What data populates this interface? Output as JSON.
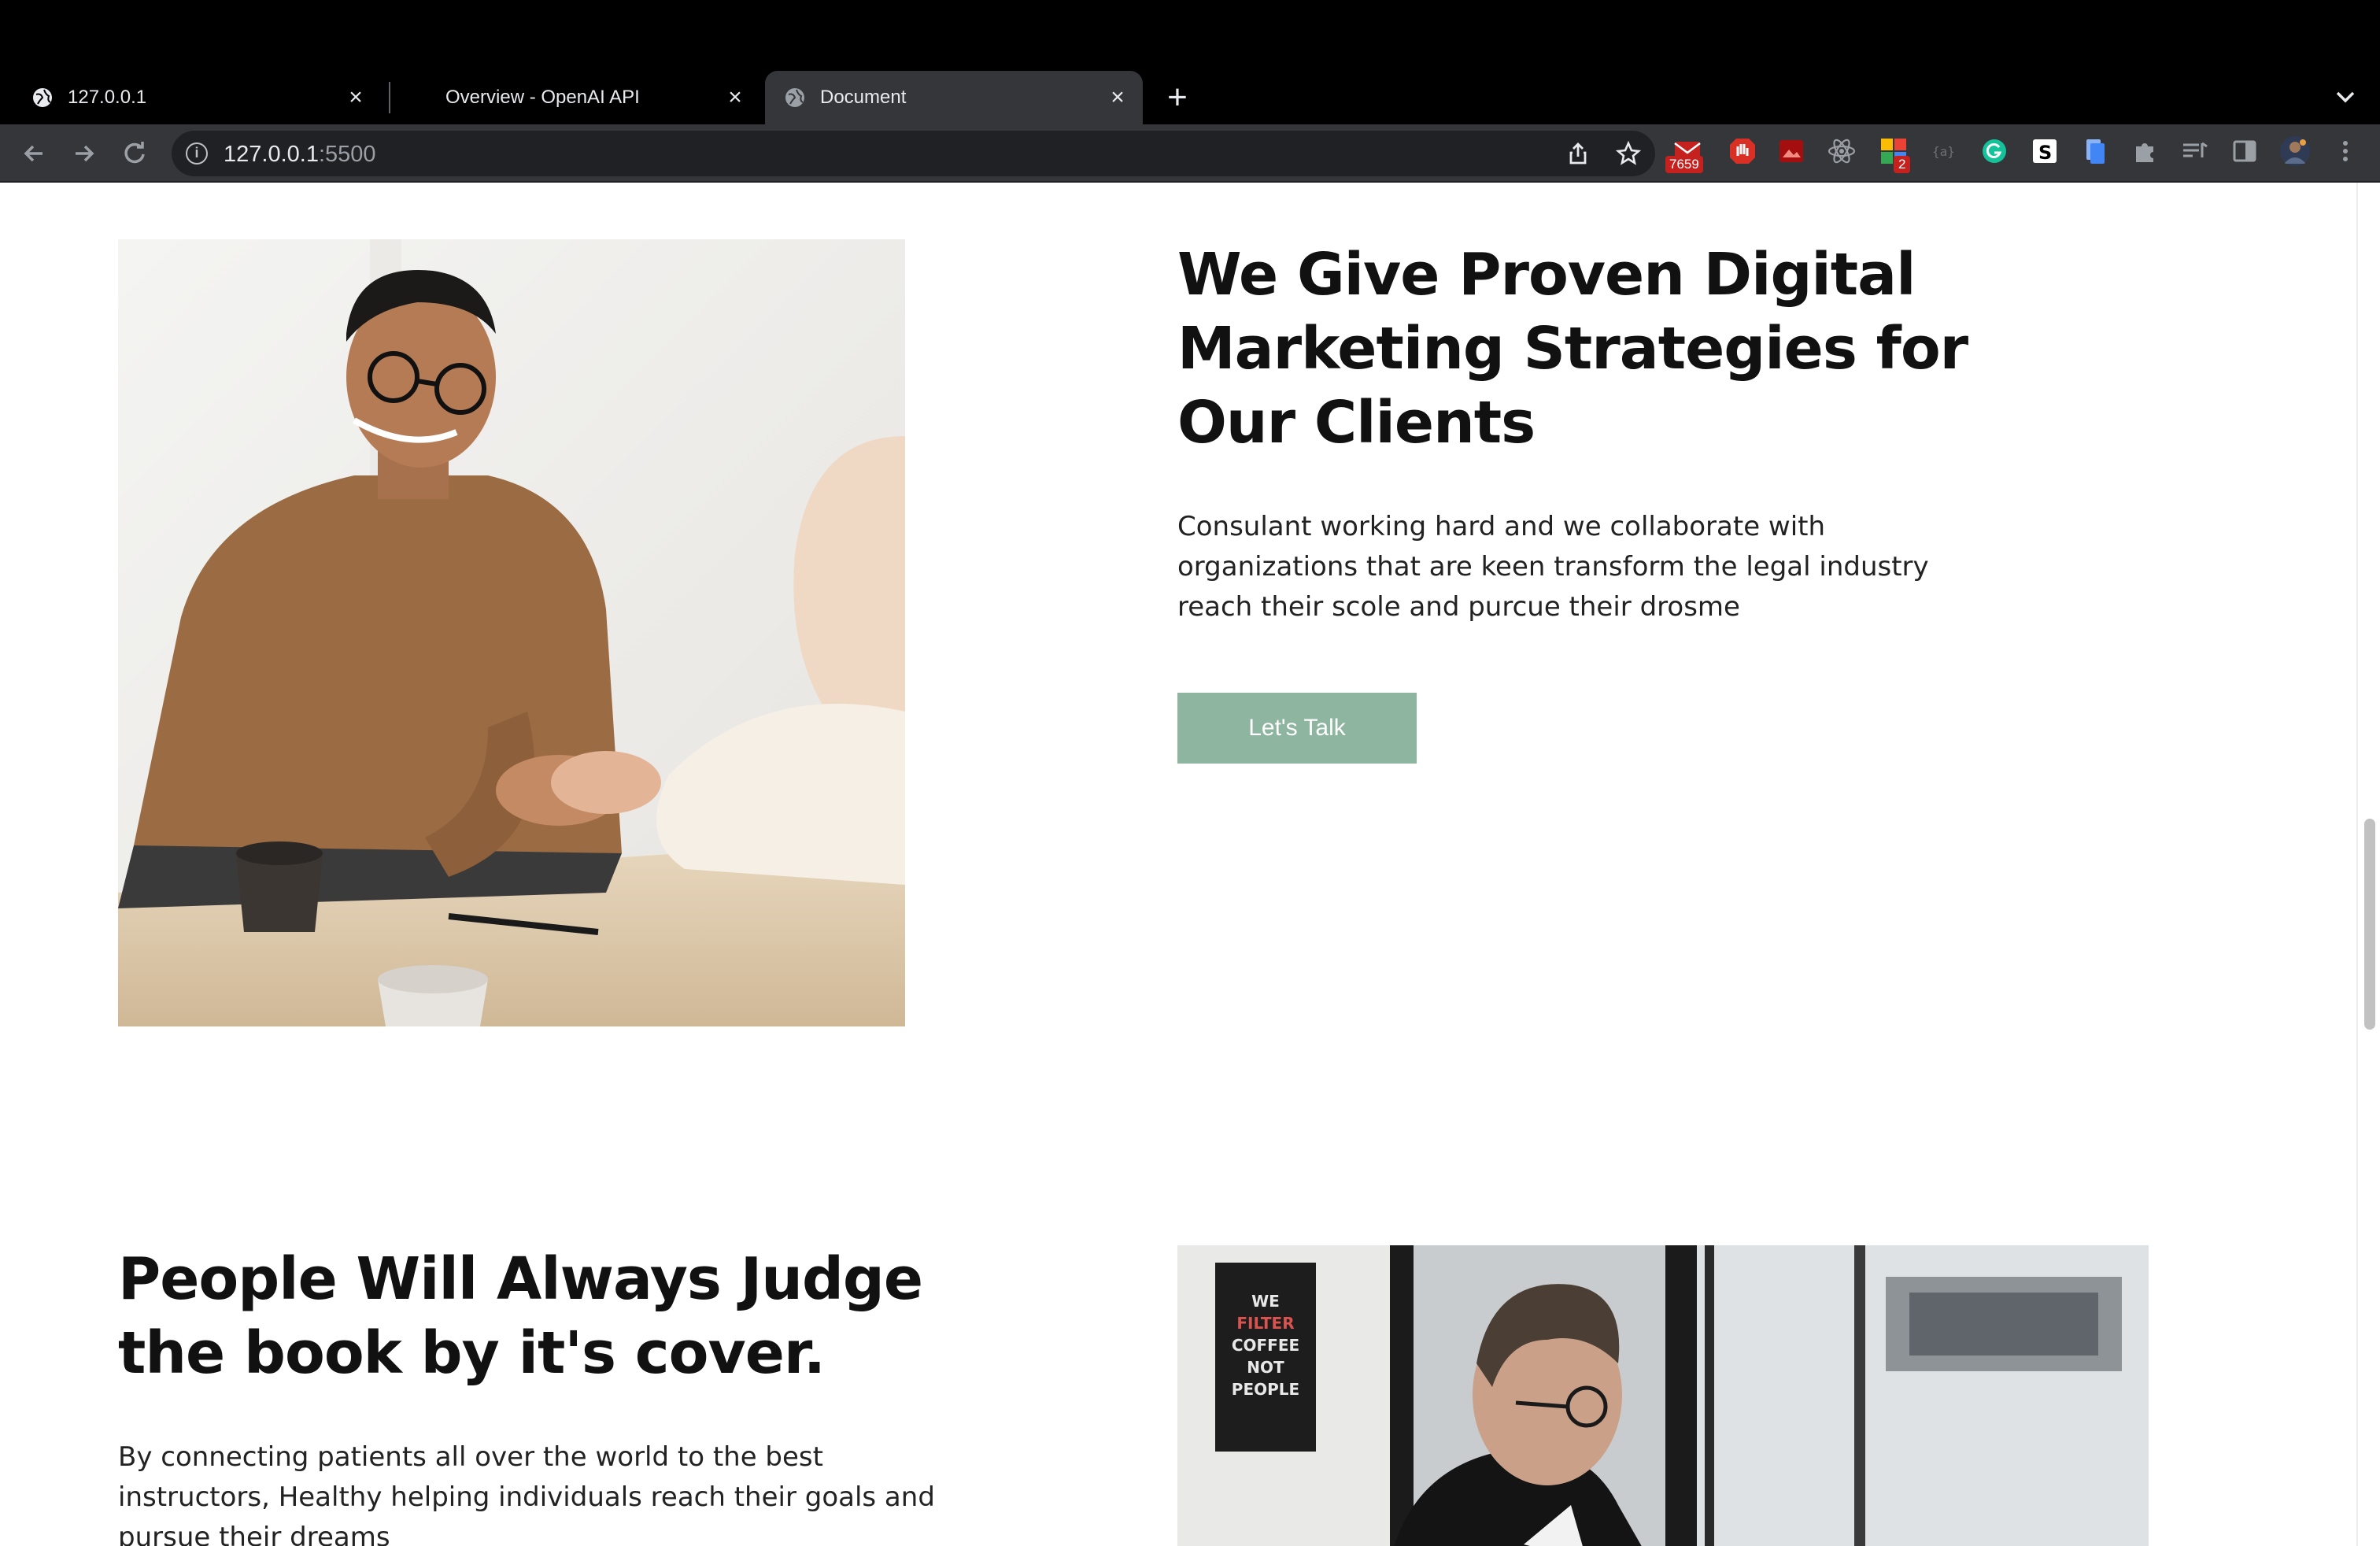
{
  "browser": {
    "tabs": [
      {
        "title": "127.0.0.1",
        "active": false
      },
      {
        "title": "Overview - OpenAI API",
        "active": false
      },
      {
        "title": "Document",
        "active": true
      }
    ],
    "new_tab_symbol": "+",
    "close_symbol": "×",
    "address": {
      "host": "127.0.0.1",
      "port": ":5500"
    },
    "extensions": [
      {
        "name": "gmail-extension-icon",
        "badge": "7659",
        "color": "#c5221f"
      },
      {
        "name": "adblock-extension-icon",
        "color": "#d93025"
      },
      {
        "name": "image-extension-icon",
        "color": "#c5221f"
      },
      {
        "name": "react-devtools-icon",
        "color": "#9aa0a6"
      },
      {
        "name": "extension-colorful-icon",
        "badge": "2",
        "color": "#34a853"
      },
      {
        "name": "json-viewer-icon",
        "color": "#5f6368"
      },
      {
        "name": "grammarly-icon",
        "color": "#15c39a"
      },
      {
        "name": "s-extension-icon",
        "color": "#ffffff"
      },
      {
        "name": "docs-extension-icon",
        "color": "#4285f4"
      },
      {
        "name": "puzzle-extensions-icon",
        "color": "#9aa0a6"
      },
      {
        "name": "reading-list-icon",
        "color": "#9aa0a6"
      },
      {
        "name": "side-panel-icon",
        "color": "#9aa0a6"
      },
      {
        "name": "profile-avatar",
        "color": "#6b7b9c"
      },
      {
        "name": "more-menu-icon",
        "color": "#9aa0a6"
      }
    ]
  },
  "section1": {
    "heading_lines": [
      "We Give Proven Digital",
      "Marketing Strategies for",
      "Our Clients"
    ],
    "paragraph_lines": [
      "Consulant working hard and we collaborate with",
      "organizations that are keen transform the legal industry",
      "reach their scole and purcue their drosme"
    ],
    "button_label": "Let's Talk",
    "image_alt": "handshake-photo"
  },
  "section2": {
    "heading_lines": [
      "People Will Always Judge",
      "the book by it's cover."
    ],
    "paragraph_lines": [
      "By connecting patients all over the world to the best",
      "instructors, Healthy helping individuals reach their goals and",
      "pursue their dreams"
    ],
    "image_alt": "man-working-photo",
    "poster_text": [
      "WE",
      "FILTER",
      "COFFEE",
      "NOT",
      "PEOPLE"
    ]
  },
  "colors": {
    "accent": "#8db5a0",
    "heading": "#111111",
    "tabstrip": "#000000",
    "toolbar": "#35363a"
  }
}
